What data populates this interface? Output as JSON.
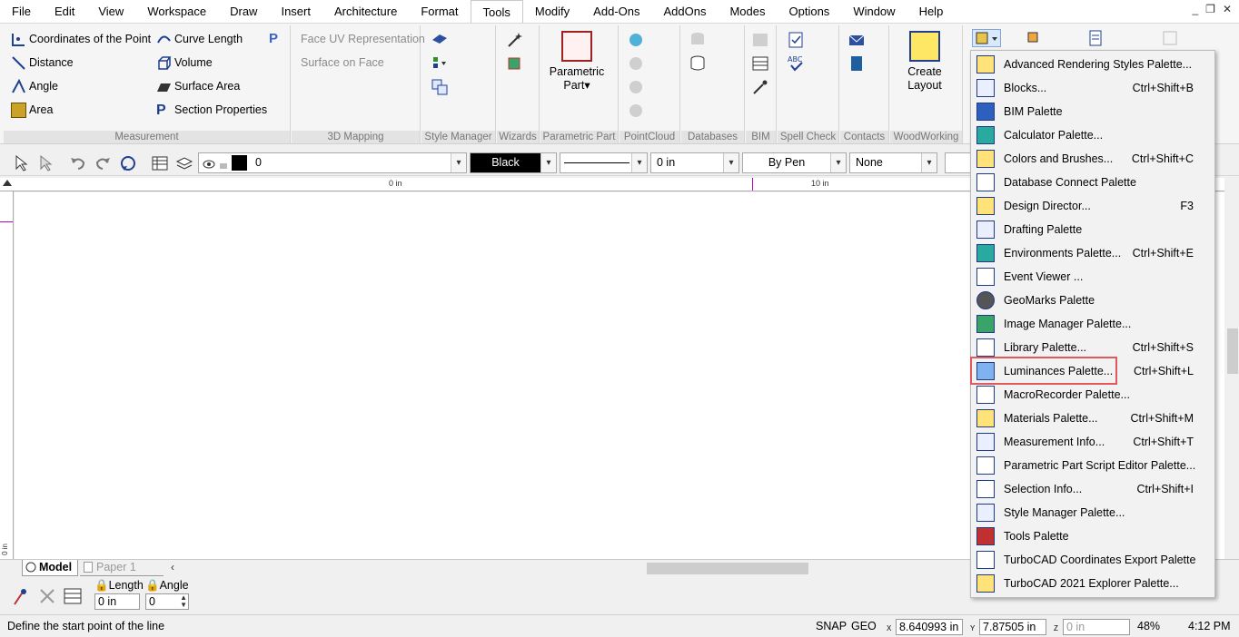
{
  "menubar": {
    "items": [
      "File",
      "Edit",
      "View",
      "Workspace",
      "Draw",
      "Insert",
      "Architecture",
      "Format",
      "Tools",
      "Modify",
      "Add-Ons",
      "AddOns",
      "Modes",
      "Options",
      "Window",
      "Help"
    ],
    "active": "Tools",
    "window_controls": [
      "_",
      "❐",
      "✕"
    ]
  },
  "ribbon": {
    "measurement": {
      "label": "Measurement",
      "items": [
        "Coordinates of the Point",
        "Distance",
        "Angle",
        "Area",
        "Curve Length",
        "Volume",
        "Surface Area",
        "Section Properties"
      ]
    },
    "mapping": {
      "label": "3D Mapping",
      "items": [
        "Face UV Representation",
        "Surface on Face"
      ]
    },
    "style_manager": {
      "label": "Style Manager"
    },
    "wizards": {
      "label": "Wizards"
    },
    "parametric_part": {
      "label": "Parametric Part",
      "button_line1": "Parametric",
      "button_line2": "Part▾"
    },
    "pointcloud": {
      "label": "PointCloud"
    },
    "databases": {
      "label": "Databases"
    },
    "bim": {
      "label": "BIM"
    },
    "spell_check": {
      "label": "Spell Check"
    },
    "contacts": {
      "label": "Contacts"
    },
    "woodworking": {
      "label": "WoodWorking",
      "button_line1": "Create",
      "button_line2": "Layout"
    }
  },
  "property_toolbar": {
    "layer_value": "0",
    "color_value": "Black",
    "line_width_value": "0 in",
    "pen_value": "By Pen",
    "fill_value": "None"
  },
  "ruler": {
    "labels": [
      "0 in",
      "10 in"
    ],
    "left_label": "0 in"
  },
  "tabs": {
    "model": "Model",
    "paper": "Paper 1"
  },
  "inspector": {
    "length_label": "Length",
    "angle_label": "Angle",
    "length_value": "0 in",
    "angle_value": "0"
  },
  "statusbar": {
    "prompt": "Define the start point of the line",
    "snap": "SNAP",
    "geo": "GEO",
    "x_label": "X",
    "y_label": "Y",
    "z_label": "Z",
    "x_value": "8.640993 in",
    "y_value": "7.87505 in",
    "z_value": "0 in",
    "zoom": "48%",
    "time": "4:12 PM"
  },
  "dropdown": {
    "items": [
      {
        "label": "Advanced Rendering Styles Palette...",
        "shortcut": ""
      },
      {
        "label": "Blocks...",
        "shortcut": "Ctrl+Shift+B"
      },
      {
        "label": "BIM Palette",
        "shortcut": ""
      },
      {
        "label": "Calculator Palette...",
        "shortcut": ""
      },
      {
        "label": "Colors and Brushes...",
        "shortcut": "Ctrl+Shift+C"
      },
      {
        "label": "Database Connect Palette",
        "shortcut": ""
      },
      {
        "label": "Design Director...",
        "shortcut": "F3"
      },
      {
        "label": "Drafting Palette",
        "shortcut": ""
      },
      {
        "label": "Environments Palette...",
        "shortcut": "Ctrl+Shift+E"
      },
      {
        "label": "Event Viewer ...",
        "shortcut": ""
      },
      {
        "label": "GeoMarks Palette",
        "shortcut": ""
      },
      {
        "label": "Image Manager Palette...",
        "shortcut": ""
      },
      {
        "label": "Library Palette...",
        "shortcut": "Ctrl+Shift+S"
      },
      {
        "label": "Luminances Palette...",
        "shortcut": "Ctrl+Shift+L"
      },
      {
        "label": "MacroRecorder Palette...",
        "shortcut": ""
      },
      {
        "label": "Materials Palette...",
        "shortcut": "Ctrl+Shift+M"
      },
      {
        "label": "Measurement Info...",
        "shortcut": "Ctrl+Shift+T"
      },
      {
        "label": "Parametric Part Script Editor Palette...",
        "shortcut": ""
      },
      {
        "label": "Selection Info...",
        "shortcut": "Ctrl+Shift+I"
      },
      {
        "label": "Style Manager Palette...",
        "shortcut": ""
      },
      {
        "label": "Tools Palette",
        "shortcut": ""
      },
      {
        "label": "TurboCAD Coordinates Export Palette",
        "shortcut": ""
      },
      {
        "label": "TurboCAD 2021 Explorer Palette...",
        "shortcut": ""
      }
    ],
    "highlighted_index": 13,
    "highlight_color": "#e05a5a"
  },
  "colors": {
    "accent": "#1f3f8f",
    "highlight": "#e05a5a",
    "color_swatch": "#000000"
  }
}
